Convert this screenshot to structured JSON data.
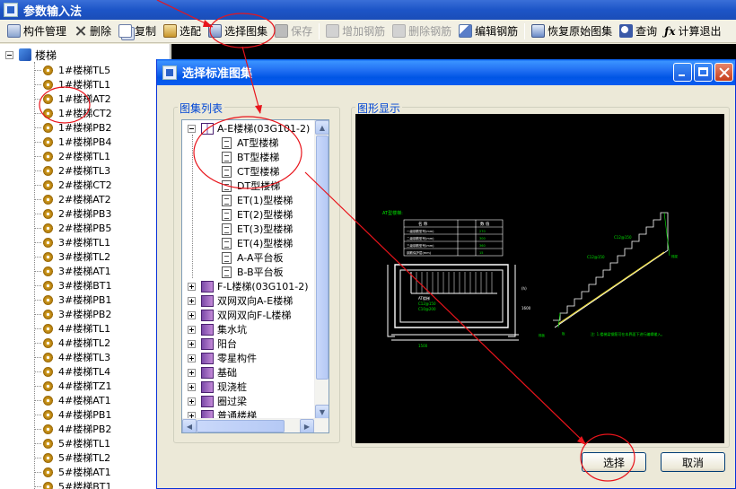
{
  "app": {
    "title": "参数输入法"
  },
  "toolbar": {
    "buttons": [
      {
        "label": "构件管理",
        "enabled": true,
        "icon": "component-manage-icon"
      },
      {
        "label": "删除",
        "enabled": true,
        "icon": "delete-icon"
      },
      {
        "label": "复制",
        "enabled": true,
        "icon": "copy-icon"
      },
      {
        "label": "选配",
        "enabled": true,
        "icon": "match-icon"
      },
      {
        "label": "选择图集",
        "enabled": true,
        "icon": "select-atlas-icon"
      },
      {
        "label": "保存",
        "enabled": false,
        "icon": "save-icon"
      },
      {
        "label": "增加钢筋",
        "enabled": false,
        "icon": "add-rebar-icon"
      },
      {
        "label": "删除钢筋",
        "enabled": false,
        "icon": "delete-rebar-icon"
      },
      {
        "label": "编辑钢筋",
        "enabled": true,
        "icon": "edit-rebar-icon"
      },
      {
        "label": "恢复原始图集",
        "enabled": true,
        "icon": "restore-atlas-icon"
      },
      {
        "label": "查询",
        "enabled": true,
        "icon": "query-icon"
      },
      {
        "label": "计算退出",
        "enabled": true,
        "icon": "fx-icon"
      }
    ]
  },
  "tree": {
    "root": "楼梯",
    "items": [
      "1#楼梯TL5",
      "1#楼梯TL1",
      "1#楼梯AT2",
      "1#楼梯CT2",
      "1#楼梯PB2",
      "1#楼梯PB4",
      "2#楼梯TL1",
      "2#楼梯TL3",
      "2#楼梯CT2",
      "2#楼梯AT2",
      "2#楼梯PB3",
      "2#楼梯PB5",
      "3#楼梯TL1",
      "3#楼梯TL2",
      "3#楼梯AT1",
      "3#楼梯BT1",
      "3#楼梯PB1",
      "3#楼梯PB2",
      "4#楼梯TL1",
      "4#楼梯TL2",
      "4#楼梯TL3",
      "4#楼梯TL4",
      "4#楼梯TZ1",
      "4#楼梯AT1",
      "4#楼梯PB1",
      "4#楼梯PB2",
      "5#楼梯TL1",
      "5#楼梯TL2",
      "5#楼梯AT1",
      "5#楼梯BT1"
    ]
  },
  "dialog": {
    "title": "选择标准图集",
    "list_group_label": "图集列表",
    "preview_group_label": "图形显示",
    "atlas_expanded": "A-E楼梯(03G101-2)",
    "atlas_children": [
      "AT型楼梯",
      "BT型楼梯",
      "CT型楼梯",
      "DT型楼梯",
      "ET(1)型楼梯",
      "ET(2)型楼梯",
      "ET(3)型楼梯",
      "ET(4)型楼梯",
      "A-A平台板",
      "B-B平台板"
    ],
    "atlas_collapsed": [
      "F-L楼梯(03G101-2)",
      "双网双向A-E楼梯",
      "双网双向F-L楼梯",
      "集水坑",
      "阳台",
      "零星构件",
      "基础",
      "现浇桩",
      "圈过梁",
      "普通楼梯"
    ],
    "select_button": "选择",
    "cancel_button": "取消"
  },
  "preview": {
    "table_title": "AT型楼梯:",
    "table_headers": [
      "名 称",
      "数 值"
    ],
    "table_rows": [
      [
        "一级钢筋型号(mm)",
        "270"
      ],
      [
        "二级钢筋型号(mm)",
        "300"
      ],
      [
        "三级钢筋型号(mm)",
        "360"
      ],
      [
        "钢筋保护层(mm)",
        "15"
      ]
    ],
    "rebar_labels": [
      "C12@150",
      "C12@150"
    ],
    "note": "注: 1.楼梯梁钢筋可在本界面下进行编辑输入。"
  },
  "colors": {
    "annotation": "#e8141b",
    "cad_line": "#ffffff",
    "cad_accent": "#00e000",
    "cad_rebar": "#f0e040"
  }
}
